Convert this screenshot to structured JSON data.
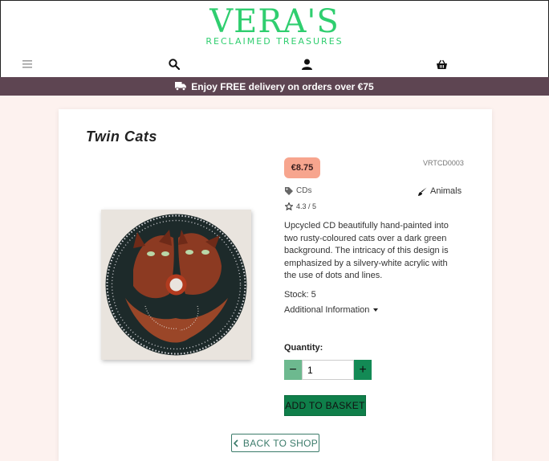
{
  "brand": {
    "name": "VERA'S",
    "tagline": "RECLAIMED TREASURES",
    "color": "#2fce6f"
  },
  "nav": {
    "menu_icon": "hamburger-icon",
    "search_icon": "search-icon",
    "account_icon": "user-icon",
    "basket_icon": "basket-icon"
  },
  "promo": {
    "icon": "truck-icon",
    "text": "Enjoy FREE delivery on orders over €75"
  },
  "product": {
    "title": "Twin Cats",
    "price": "€8.75",
    "sku": "VRTCD0003",
    "category": "CDs",
    "tag": "Animals",
    "rating": "4.3 / 5",
    "description": "Upcycled CD beautifully hand-painted into two rusty-coloured cats over a dark green background. The intricacy of this design is emphasized by a silvery-white acrylic with the use of dots and lines.",
    "stock": "Stock: 5",
    "additional_info": "Additional Information"
  },
  "quantity": {
    "label": "Quantity:",
    "value": "1",
    "minus": "−",
    "plus": "+"
  },
  "actions": {
    "add_to_basket": "ADD TO BASKET",
    "back_to_shop": "BACK TO SHOP"
  },
  "colors": {
    "promo_bg": "#5e4552",
    "page_bg": "#fdf2ef",
    "price_badge": "#f7a58e",
    "primary_button": "#0f7f4a",
    "outline_button": "#3b7b6a"
  }
}
